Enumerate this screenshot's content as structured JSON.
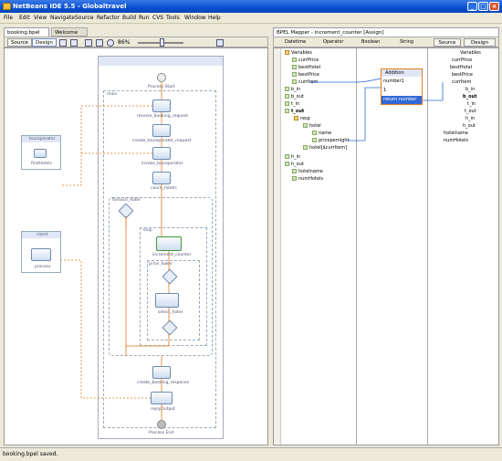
{
  "window": {
    "title": "NetBeans IDE 5.5 - Globaltravel"
  },
  "menu": [
    "File",
    "Edit",
    "View",
    "Navigate",
    "Source",
    "Refactor",
    "Build",
    "Run",
    "CVS",
    "Tools",
    "Window",
    "Help"
  ],
  "editor": {
    "tabs": [
      "booking.bpel",
      "Welcome"
    ],
    "source_label": "Source",
    "design_label": "Design",
    "zoom": "86%"
  },
  "process": {
    "partners": {
      "touroperator": "touroperator",
      "findHotels": "findHotels",
      "client": "client",
      "process": "process"
    },
    "labels": {
      "start": "Process Start",
      "main": "main",
      "receive": "receive_booking_request",
      "create_touroperator": "create_touroperator_request",
      "invoke": "invoke_touroperator",
      "count": "count_hotels",
      "foreach": "foreach_hotel",
      "loop": "loop",
      "increment": "increment_counter",
      "price_lower": "price_lower",
      "select": "select_hotel",
      "create_response": "create_booking_response",
      "reply": "replyOutput",
      "end": "Process End"
    }
  },
  "mapper": {
    "title": "BPEL Mapper - increment_counter [Assign]",
    "menus": [
      "Datetime",
      "Operator",
      "Boolean",
      "String"
    ],
    "source_label": "Source",
    "design_label": "Design",
    "left_tree": [
      "Variables",
      "currPrice",
      "bestHotel",
      "bestPrice",
      "currItem",
      "b_in",
      "b_out",
      "t_in",
      "t_out",
      "resp",
      "hotel",
      "name",
      "pricepernight",
      "hotel[$currItem]",
      "h_in",
      "h_out",
      "hotelname",
      "numHotels"
    ],
    "right_tree": [
      "Variables",
      "currPrice",
      "bestHotel",
      "bestPrice",
      "currItem",
      "b_in",
      "b_out",
      "t_in",
      "t_out",
      "h_in",
      "h_out",
      "hotelname",
      "numHotels"
    ],
    "operator": {
      "title": "Addition",
      "in1": "number1",
      "in2": "1",
      "out": "return number"
    }
  },
  "status": {
    "text": "booking.bpel saved."
  },
  "colors": {
    "accent": "#0a4fd0",
    "selection": "#3168d5",
    "flow": "#e07a20"
  }
}
